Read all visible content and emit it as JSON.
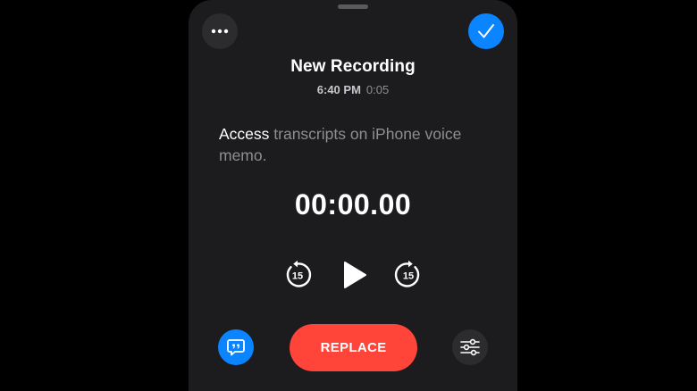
{
  "header": {
    "more_icon": "ellipsis-icon",
    "done_icon": "checkmark-icon"
  },
  "recording": {
    "title": "New Recording",
    "time": "6:40 PM",
    "duration": "0:05"
  },
  "transcript": {
    "highlighted_word": "Access",
    "rest_text": " transcripts on iPhone voice memo."
  },
  "player": {
    "timer": "00:00.00",
    "skip_back_icon": "skip-back-15-icon",
    "skip_back_label": "15",
    "play_icon": "play-icon",
    "skip_forward_icon": "skip-forward-15-icon",
    "skip_forward_label": "15"
  },
  "footer": {
    "transcript_icon": "transcript-quote-icon",
    "replace_label": "REPLACE",
    "settings_icon": "sliders-icon"
  },
  "colors": {
    "accent_blue": "#0a84ff",
    "replace_red": "#ff453a",
    "sheet_background": "#1c1c1e",
    "button_background": "#2c2c2e"
  }
}
